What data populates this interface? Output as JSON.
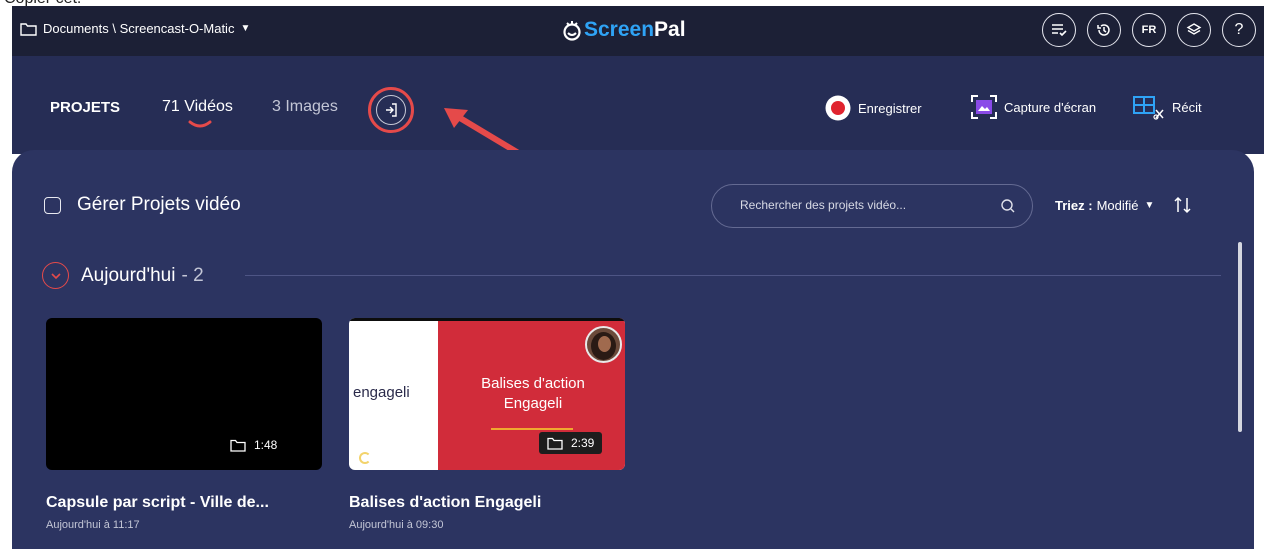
{
  "top_cut_text": "Copier cet.",
  "topbar": {
    "location": "Documents \\ Screencast-O-Matic",
    "logo_part1": "Screen",
    "logo_part2": "Pal",
    "lang": "FR",
    "help": "?"
  },
  "tabs": {
    "projects": "PROJETS",
    "videos": "71 Vidéos",
    "images": "3 Images"
  },
  "actions": {
    "record": "Enregistrer",
    "capture": "Capture d'écran",
    "story": "Récit"
  },
  "toolbar": {
    "manage": "Gérer Projets vidéo",
    "search_placeholder": "Rechercher des projets vidéo...",
    "sort_label": "Triez :",
    "sort_value": "Modifié"
  },
  "section": {
    "title": "Aujourd'hui",
    "count": "- 2"
  },
  "videos": [
    {
      "title": "Capsule par script - Ville de...",
      "date": "Aujourd'hui à 11:17",
      "duration": "1:48"
    },
    {
      "title": "Balises d'action Engageli",
      "date": "Aujourd'hui à 09:30",
      "duration": "2:39",
      "thumb_brand": "engageli",
      "thumb_text_1": "Balises d'action",
      "thumb_text_2": "Engageli"
    }
  ],
  "colors": {
    "topbar_bg": "#1c2036",
    "subbar_bg": "#262d55",
    "panel_bg": "#2c3461",
    "accent_red": "#e54a4a",
    "logo_blue": "#2fa3f5"
  }
}
